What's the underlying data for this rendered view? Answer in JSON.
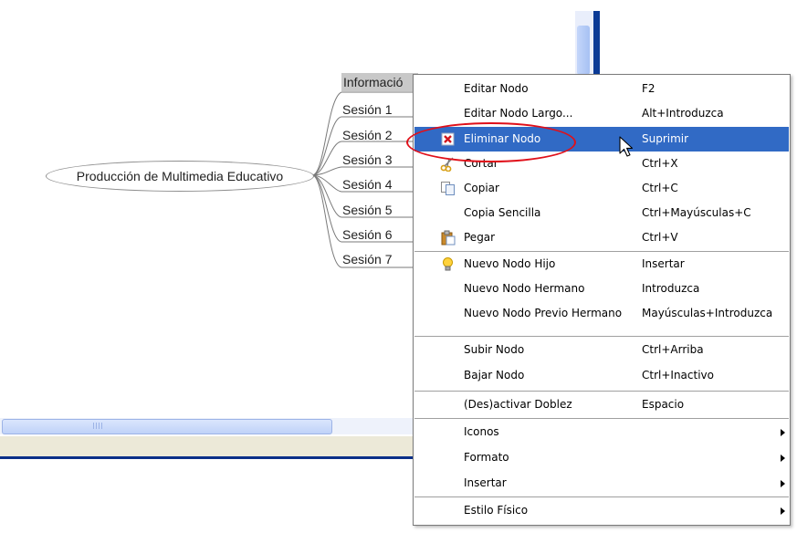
{
  "mindmap": {
    "root": "Producción de Multimedia Educativo",
    "children": [
      "Informació",
      "Sesión 1",
      "Sesión 2",
      "Sesión 3",
      "Sesión 4",
      "Sesión 5",
      "Sesión 6",
      "Sesión 7"
    ]
  },
  "hscroll": {
    "grip": "||||"
  },
  "context_menu": {
    "items": [
      {
        "label": "Editar Nodo",
        "shortcut": "F2"
      },
      {
        "label": "Editar Nodo Largo...",
        "shortcut": "Alt+Introduzca"
      },
      {
        "label": "Eliminar Nodo",
        "shortcut": "Suprimir",
        "icon": "delete-icon",
        "highlighted": true
      },
      {
        "label": "Cortar",
        "shortcut": "Ctrl+X",
        "icon": "scissors-icon"
      },
      {
        "label": "Copiar",
        "shortcut": "Ctrl+C",
        "icon": "copy-icon"
      },
      {
        "label": "Copia Sencilla",
        "shortcut": "Ctrl+Mayúsculas+C"
      },
      {
        "label": "Pegar",
        "shortcut": "Ctrl+V",
        "icon": "paste-icon"
      },
      {
        "label": "Nuevo Nodo Hijo",
        "shortcut": "Insertar",
        "icon": "lightbulb-icon"
      },
      {
        "label": "Nuevo Nodo Hermano",
        "shortcut": "Introduzca"
      },
      {
        "label": "Nuevo Nodo Previo Hermano",
        "shortcut": "Mayúsculas+Introduzca"
      },
      {
        "label": "Subir Nodo",
        "shortcut": "Ctrl+Arriba"
      },
      {
        "label": "Bajar Nodo",
        "shortcut": "Ctrl+Inactivo"
      },
      {
        "label": "(Des)activar Doblez",
        "shortcut": "Espacio"
      },
      {
        "label": "Iconos",
        "submenu": true
      },
      {
        "label": "Formato",
        "submenu": true
      },
      {
        "label": "Insertar",
        "submenu": true
      },
      {
        "label": "Estilo Físico",
        "submenu": true
      }
    ]
  },
  "colors": {
    "highlight": "#316ac5",
    "annotation": "#e0101a",
    "scroll_accent": "#0a3a96"
  }
}
